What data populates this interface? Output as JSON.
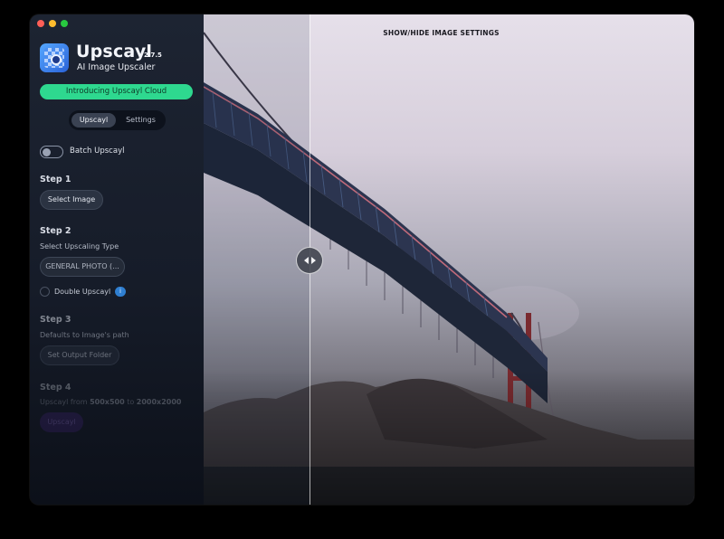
{
  "window": {
    "controls": [
      "close",
      "minimize",
      "maximize"
    ]
  },
  "sidebar": {
    "app_name": "Upscayl",
    "version": "2.7.5",
    "tagline": "AI Image Upscaler",
    "cloud_button": "Introducing Upscayl Cloud",
    "tabs": [
      {
        "label": "Upscayl",
        "active": true
      },
      {
        "label": "Settings",
        "active": false
      }
    ],
    "batch_label": "Batch Upscayl",
    "batch_enabled": false,
    "step1": {
      "title": "Step 1",
      "button": "Select Image"
    },
    "step2": {
      "title": "Step 2",
      "subtitle": "Select Upscaling Type",
      "model_value": "GENERAL PHOTO (...",
      "double_label": "Double Upscayl",
      "info_badge": "i"
    },
    "step3": {
      "title": "Step 3",
      "subtitle": "Defaults to Image's path",
      "button": "Set Output Folder"
    },
    "step4": {
      "title": "Step 4",
      "res_prefix": "Upscayl from",
      "res_from": "500x500",
      "res_mid": "to",
      "res_to": "2000x2000",
      "button": "Upscayl"
    }
  },
  "preview": {
    "settings_toggle": "SHOW/HIDE IMAGE SETTINGS"
  },
  "colors": {
    "accent_green": "#2ed88f",
    "sidebar_bg": "#1d2432",
    "upscayl_button": "#3a1f6b"
  },
  "icons": {
    "logo": "upscayl-logo-icon",
    "compare": "compare-slider-arrows-icon",
    "info": "info-icon"
  }
}
